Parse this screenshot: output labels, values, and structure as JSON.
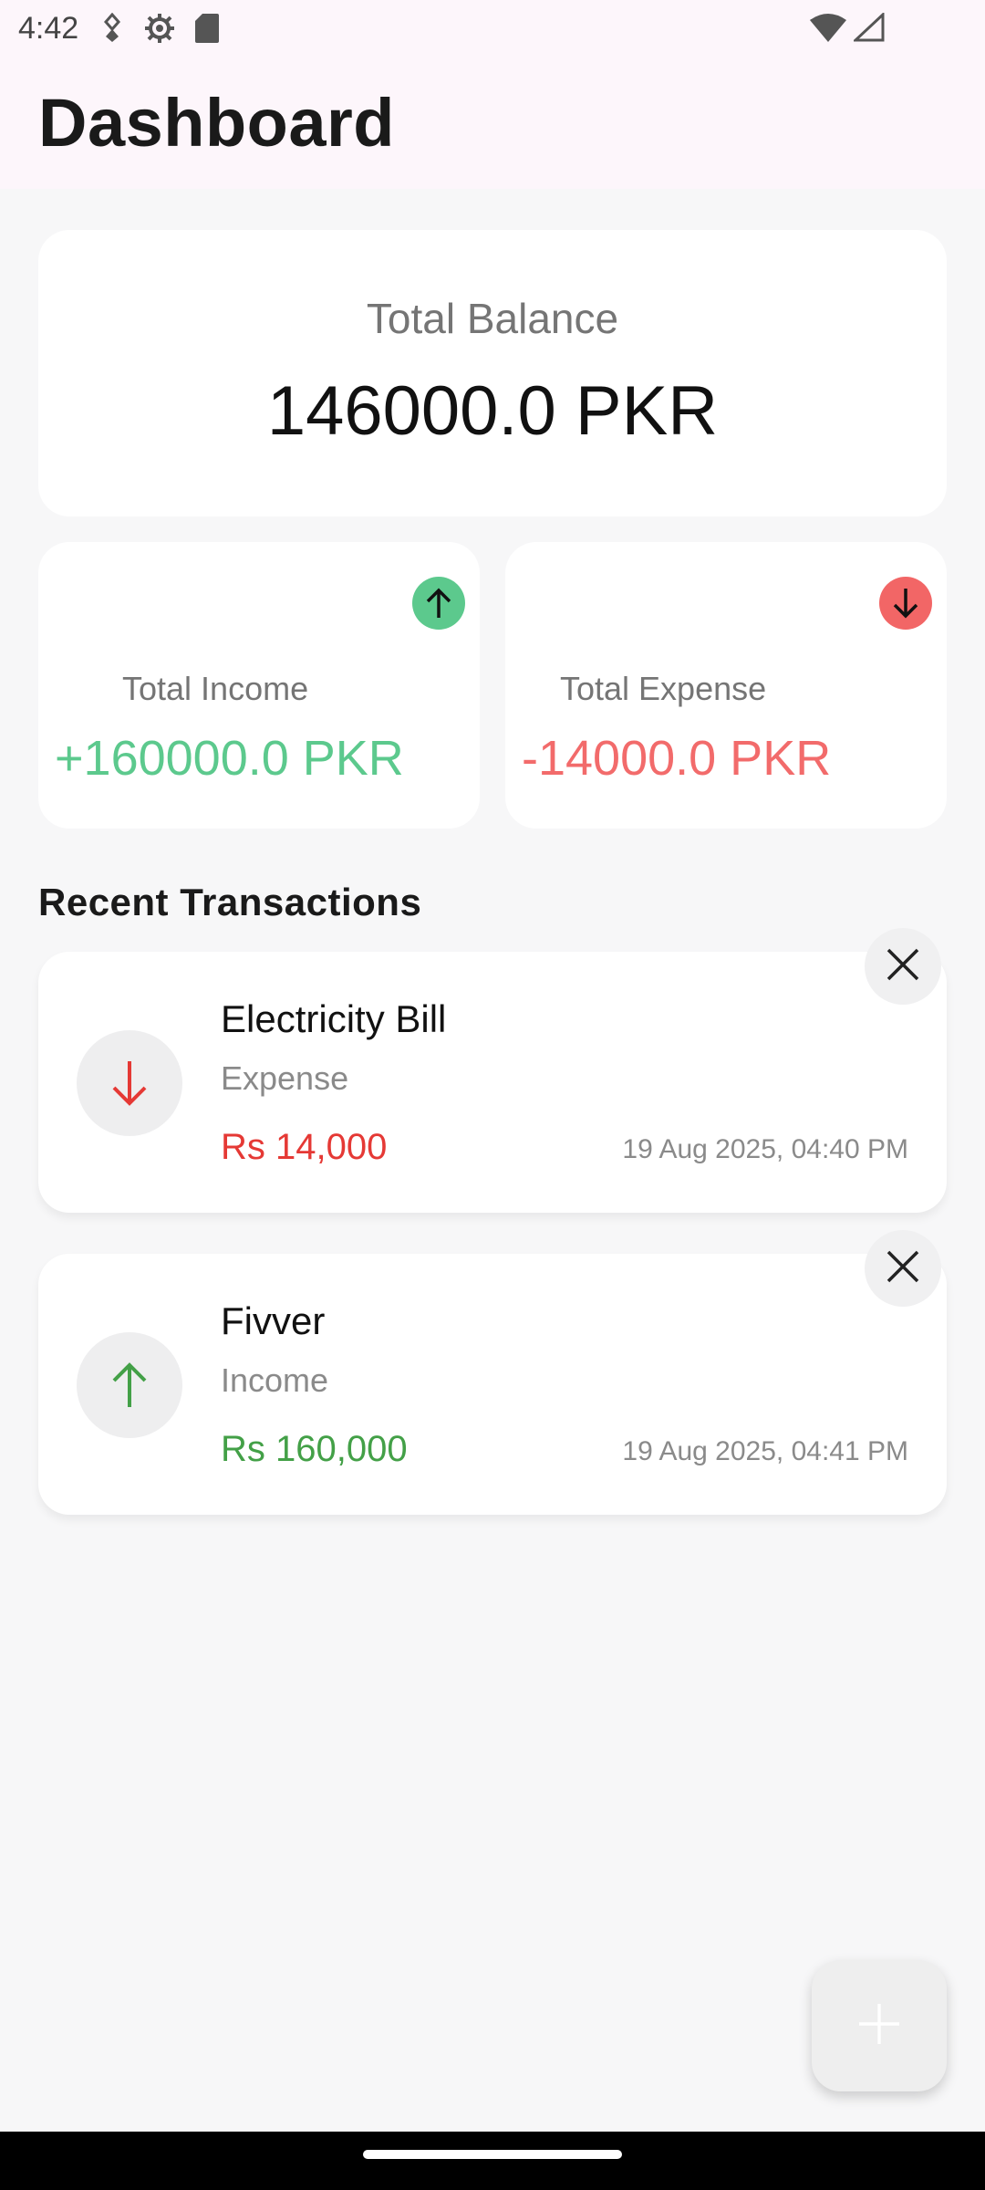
{
  "status_bar": {
    "time": "4:42",
    "icons_left": [
      "accessibility-icon",
      "gear-icon",
      "sd-card-icon"
    ],
    "icons_right": [
      "wifi-icon",
      "signal-icon"
    ]
  },
  "app_bar": {
    "title": "Dashboard"
  },
  "balance": {
    "label": "Total Balance",
    "amount": "146000.0 PKR"
  },
  "income": {
    "label": "Total Income",
    "amount": "+160000.0 PKR",
    "color": "#5cc98d",
    "icon": "arrow-up-icon"
  },
  "expense": {
    "label": "Total Expense",
    "amount": "-14000.0 PKR",
    "color": "#f26b6b",
    "icon": "arrow-down-icon"
  },
  "recent": {
    "title": "Recent Transactions",
    "transactions": [
      {
        "name": "Electricity Bill",
        "type": "Expense",
        "amount": "Rs 14,000",
        "date": "19 Aug 2025, 04:40 PM",
        "icon": "arrow-down-icon",
        "color": "#e53935"
      },
      {
        "name": "Fivver",
        "type": "Income",
        "amount": "Rs 160,000",
        "date": "19 Aug 2025, 04:41 PM",
        "icon": "arrow-up-icon",
        "color": "#43a047"
      }
    ]
  },
  "fab": {
    "icon": "plus-icon"
  }
}
